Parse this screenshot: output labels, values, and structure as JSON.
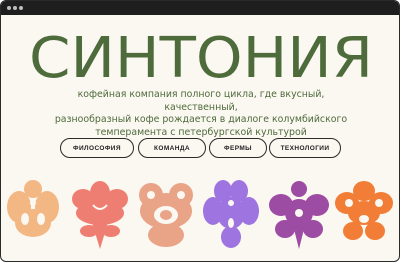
{
  "brand": {
    "name": "СИНТОНИЯ"
  },
  "tagline": {
    "line1": "кофейная компания полного цикла, где вкусный, качественный,",
    "line2": "разнообразный кофе рождается в диалоге колумбийского",
    "line3": "темперамента с петербургской культурой"
  },
  "nav": {
    "items": [
      {
        "label": "ФИЛОСОФИЯ"
      },
      {
        "label": "КОМАНДА"
      },
      {
        "label": "ФЕРМЫ"
      },
      {
        "label": "ТЕХНОЛОГИИ"
      }
    ]
  },
  "colors": {
    "logo": "#4d6b3b",
    "flower_1": "#f3b784",
    "flower_2": "#ef7e72",
    "flower_3": "#e9a386",
    "flower_4": "#9e74e0",
    "flower_5": "#9d4ca3",
    "flower_6": "#f27d36"
  },
  "icons": [
    "flower-yellow-icon",
    "flower-coral-icon",
    "flower-peach-icon",
    "flower-lavender-icon",
    "flower-purple-icon",
    "flower-orange-icon"
  ]
}
